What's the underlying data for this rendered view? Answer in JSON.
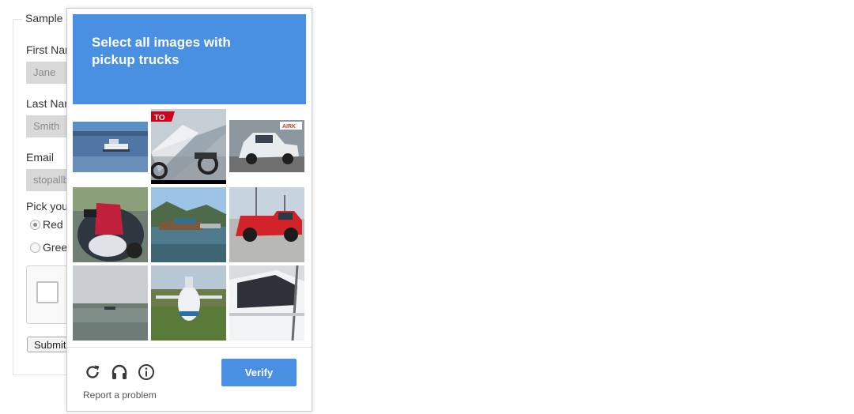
{
  "form": {
    "legend": "Sample",
    "first_name_label": "First Nar",
    "first_name_value": "Jane",
    "last_name_label": "Last Nar",
    "last_name_value": "Smith",
    "email_label": "Email",
    "email_value": "stopallb",
    "pick_label": "Pick you",
    "radios": [
      {
        "label": "Red",
        "selected": true
      },
      {
        "label": "Greer",
        "selected": false
      }
    ],
    "submit_label": "Submit"
  },
  "challenge": {
    "title_line1": "Select all images with",
    "title_line2": "pickup trucks",
    "tiles": [
      {
        "subject": "boat-on-lake"
      },
      {
        "subject": "motorcycle-dealership"
      },
      {
        "subject": "white-pickup-truck"
      },
      {
        "subject": "motorcycle-closeup"
      },
      {
        "subject": "boats-at-dock"
      },
      {
        "subject": "red-pickup-truck"
      },
      {
        "subject": "lake-boat-distant"
      },
      {
        "subject": "small-airplane"
      },
      {
        "subject": "white-car-side"
      }
    ],
    "tile2_sign_text": "TO",
    "tile3_sign_text": "AIRK",
    "tools": [
      "reload-icon",
      "audio-icon",
      "info-icon"
    ],
    "report_label": "Report a problem",
    "verify_label": "Verify",
    "accent_color": "#4a90e2"
  }
}
